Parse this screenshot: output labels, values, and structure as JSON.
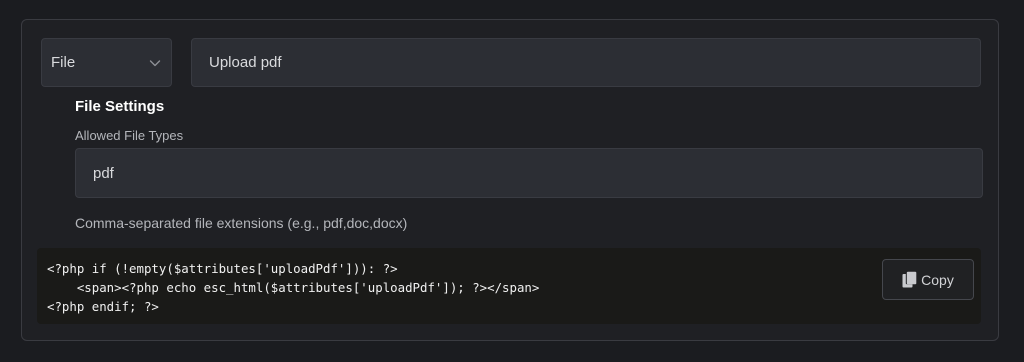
{
  "field": {
    "type_select": {
      "selected": "File",
      "icon": "chevron-down-icon"
    },
    "label_input": {
      "value": "Upload pdf"
    }
  },
  "file_settings": {
    "title": "File Settings",
    "allowed_types_label": "Allowed File Types",
    "allowed_types_value": "pdf",
    "help_text": "Comma-separated file extensions (e.g., pdf,doc,docx)"
  },
  "code_snippet": {
    "lines": [
      "<?php if (!empty($attributes['uploadPdf'])): ?>",
      "    <span><?php echo esc_html($attributes['uploadPdf']); ?></span>",
      "<?php endif; ?>"
    ],
    "copy_label": "Copy",
    "copy_icon": "copy-icon"
  },
  "colors": {
    "background": "#1b1c20",
    "panel": "#1f2024",
    "input": "#2c2e34",
    "code_background": "#1a1a18"
  }
}
